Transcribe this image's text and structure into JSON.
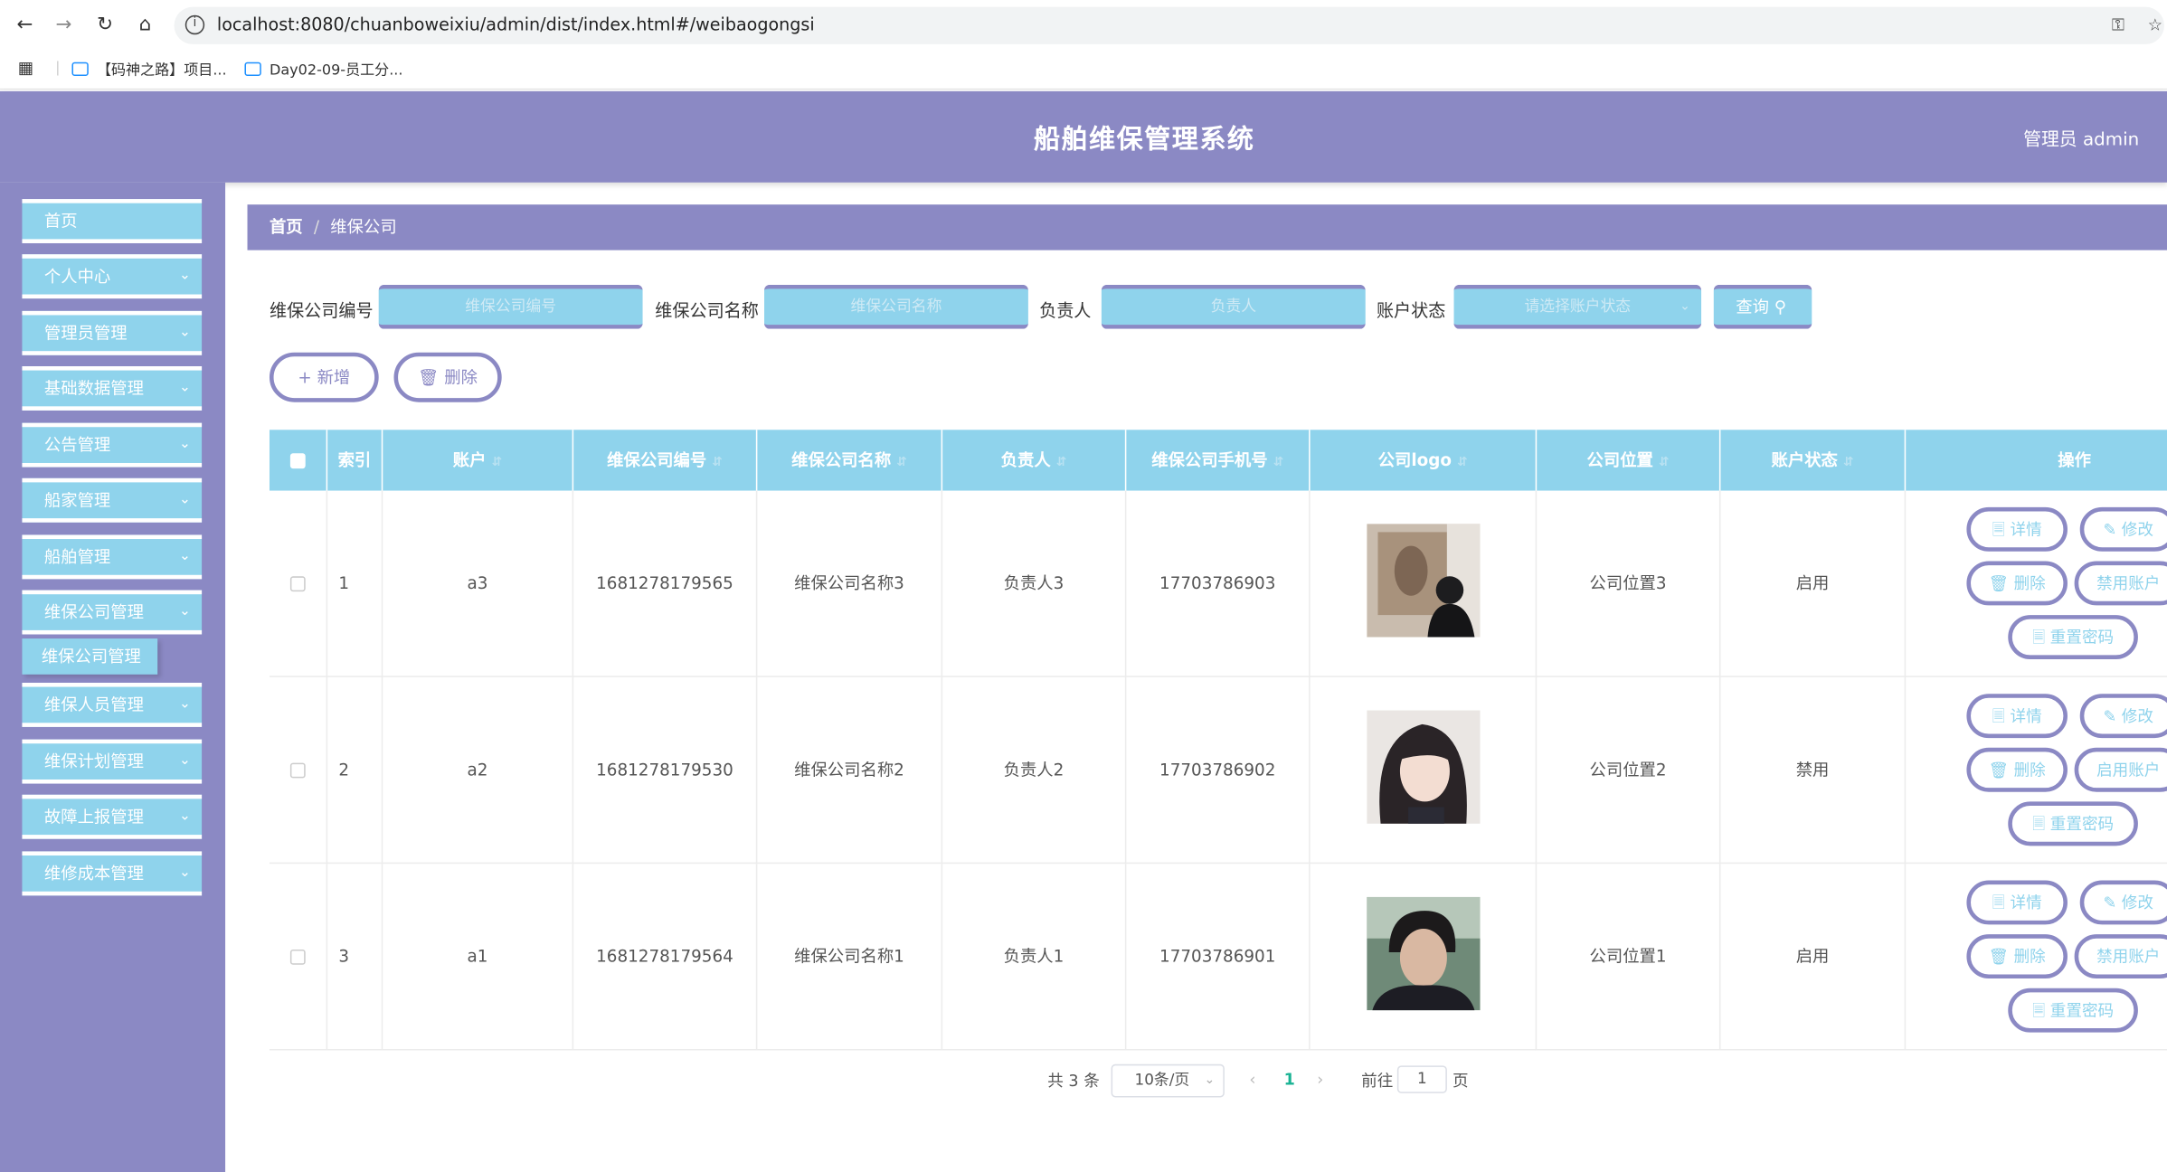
{
  "browser": {
    "url": "localhost:8080/chuanboweixiu/admin/dist/index.html#/weibaogongsi",
    "bookmarks": [
      "【码神之路】项目...",
      "Day02-09-员工分..."
    ]
  },
  "header": {
    "title": "船舶维保管理系统",
    "user": "管理员 admin"
  },
  "sidebar": {
    "items": [
      {
        "label": "首页",
        "has_arrow": false
      },
      {
        "label": "个人中心",
        "has_arrow": true
      },
      {
        "label": "管理员管理",
        "has_arrow": true
      },
      {
        "label": "基础数据管理",
        "has_arrow": true
      },
      {
        "label": "公告管理",
        "has_arrow": true
      },
      {
        "label": "船家管理",
        "has_arrow": true
      },
      {
        "label": "船舶管理",
        "has_arrow": true
      },
      {
        "label": "维保公司管理",
        "has_arrow": true
      },
      {
        "label": "维保人员管理",
        "has_arrow": true
      },
      {
        "label": "维保计划管理",
        "has_arrow": true
      },
      {
        "label": "故障上报管理",
        "has_arrow": true
      },
      {
        "label": "维修成本管理",
        "has_arrow": true
      }
    ],
    "active_sub": "维保公司管理"
  },
  "breadcrumb": {
    "home": "首页",
    "current": "维保公司"
  },
  "filters": {
    "code_label": "维保公司编号",
    "code_placeholder": "维保公司编号",
    "name_label": "维保公司名称",
    "name_placeholder": "维保公司名称",
    "owner_label": "负责人",
    "owner_placeholder": "负责人",
    "status_label": "账户状态",
    "status_placeholder": "请选择账户状态",
    "query": "查询"
  },
  "actions": {
    "add": "新增",
    "delete": "删除"
  },
  "table": {
    "columns": [
      "索引",
      "账户",
      "维保公司编号",
      "维保公司名称",
      "负责人",
      "维保公司手机号",
      "公司logo",
      "公司位置",
      "账户状态",
      "操作"
    ],
    "rows": [
      {
        "index": "1",
        "account": "a3",
        "code": "1681278179565",
        "name": "维保公司名称3",
        "owner": "负责人3",
        "phone": "17703786903",
        "location": "公司位置3",
        "status": "启用",
        "toggle": "禁用账户"
      },
      {
        "index": "2",
        "account": "a2",
        "code": "1681278179530",
        "name": "维保公司名称2",
        "owner": "负责人2",
        "phone": "17703786902",
        "location": "公司位置2",
        "status": "禁用",
        "toggle": "启用账户"
      },
      {
        "index": "3",
        "account": "a1",
        "code": "1681278179564",
        "name": "维保公司名称1",
        "owner": "负责人1",
        "phone": "17703786901",
        "location": "公司位置1",
        "status": "启用",
        "toggle": "禁用账户"
      }
    ],
    "op_labels": {
      "detail": "详情",
      "edit": "修改",
      "delete": "删除",
      "reset": "重置密码"
    }
  },
  "pagination": {
    "total": "共 3 条",
    "page_size": "10条/页",
    "current_page": "1",
    "goto": "前往",
    "goto_value": "1",
    "page_unit": "页"
  },
  "colors": {
    "primary": "#8b89c4",
    "accent": "#8fd3ec"
  }
}
